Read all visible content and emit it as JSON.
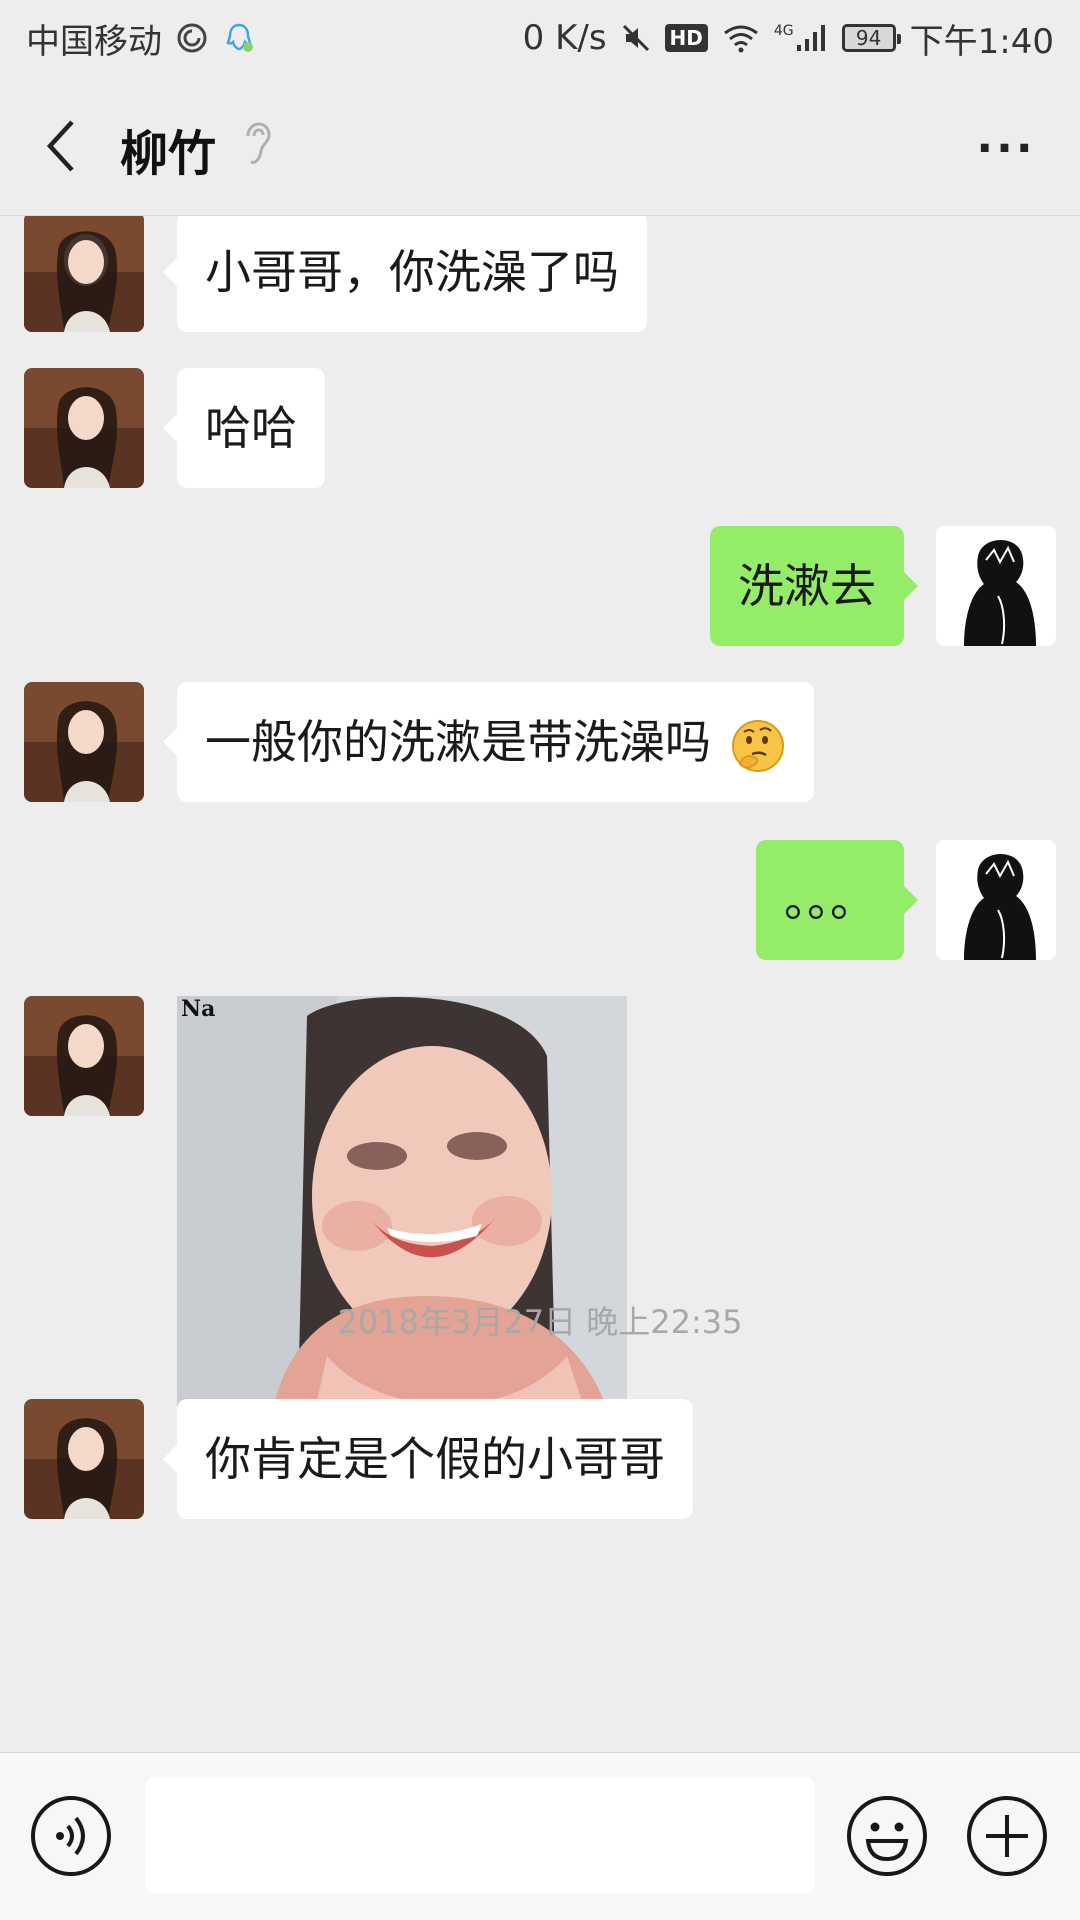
{
  "status_bar": {
    "carrier": "中国移动",
    "net_speed": "0 K/s",
    "hd": "HD",
    "network": "4G",
    "battery": "94",
    "time": "下午1:40"
  },
  "header": {
    "title": "柳竹",
    "back_icon": "chevron-left-icon",
    "more_label": "···"
  },
  "messages": [
    {
      "side": "in",
      "text": "小哥哥，你洗澡了吗"
    },
    {
      "side": "in",
      "text": "哈哈"
    },
    {
      "side": "out",
      "text": "洗漱去"
    },
    {
      "side": "in",
      "text": "一般你的洗漱是带洗澡吗",
      "emoji": "thinking-face"
    },
    {
      "side": "out",
      "text": "。。。"
    },
    {
      "side": "in",
      "type": "sticker",
      "watermark": "Na"
    },
    {
      "side": "in",
      "text": "你肯定是个假的小哥哥"
    }
  ],
  "timestamp": "2018年3月27日 晚上22:35",
  "input_bar": {
    "value": "",
    "icons": [
      "voice-icon",
      "emoji-icon",
      "plus-icon"
    ]
  },
  "colors": {
    "background": "#EDEDED",
    "bubble_in": "#FFFFFF",
    "bubble_out": "#95EC69",
    "timestamp": "#A8A8A8"
  }
}
